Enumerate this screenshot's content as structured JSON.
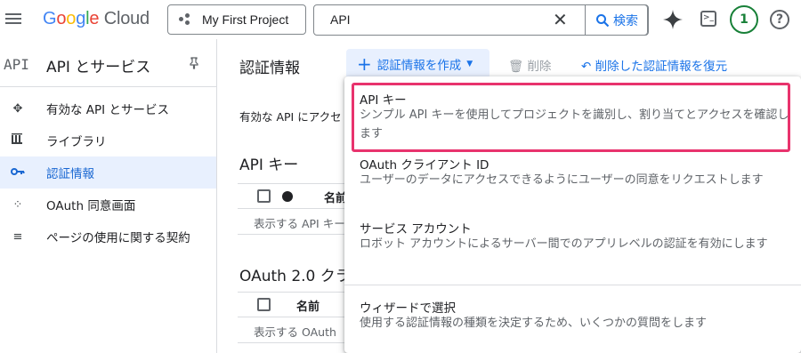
{
  "topbar": {
    "logo": "Google Cloud",
    "project": "My First Project",
    "search_value": "API",
    "search_button": "検索",
    "notification_count": "1"
  },
  "sidebar": {
    "api_mark": "API",
    "title": "API とサービス",
    "items": [
      {
        "label": "有効な API とサービス",
        "icon": "services-icon"
      },
      {
        "label": "ライブラリ",
        "icon": "library-icon"
      },
      {
        "label": "認証情報",
        "icon": "key-icon",
        "active": true
      },
      {
        "label": "OAuth 同意画面",
        "icon": "oauth-icon"
      },
      {
        "label": "ページの使用に関する契約",
        "icon": "settings-list-icon"
      }
    ]
  },
  "main": {
    "title": "認証情報",
    "create_button": "認証情報を作成",
    "delete_button": "削除",
    "restore_button": "削除した認証情報を復元",
    "intro": "有効な API にアクセ",
    "api_keys": {
      "title": "API キー",
      "col_name": "名前",
      "empty": "表示する API キー"
    },
    "oauth": {
      "title": "OAuth 2.0 クラ",
      "col_name": "名前",
      "empty": "表示する OAuth"
    }
  },
  "menu": {
    "options": [
      {
        "title": "API キー",
        "desc": "シンプル API キーを使用してプロジェクトを識別し、割り当てとアクセスを確認します"
      },
      {
        "title": "OAuth クライアント ID",
        "desc": "ユーザーのデータにアクセスできるようにユーザーの同意をリクエストします"
      },
      {
        "title": "サービス アカウント",
        "desc": "ロボット アカウントによるサーバー間でのアプリレベルの認証を有効にします"
      },
      {
        "title": "ウィザードで選択",
        "desc": "使用する認証情報の種類を決定するため、いくつかの質問をします"
      }
    ]
  },
  "colors": {
    "accent": "#1a73e8",
    "active_bg": "#e8f0fe",
    "highlight": "#e8336d",
    "badge": "#188038"
  }
}
